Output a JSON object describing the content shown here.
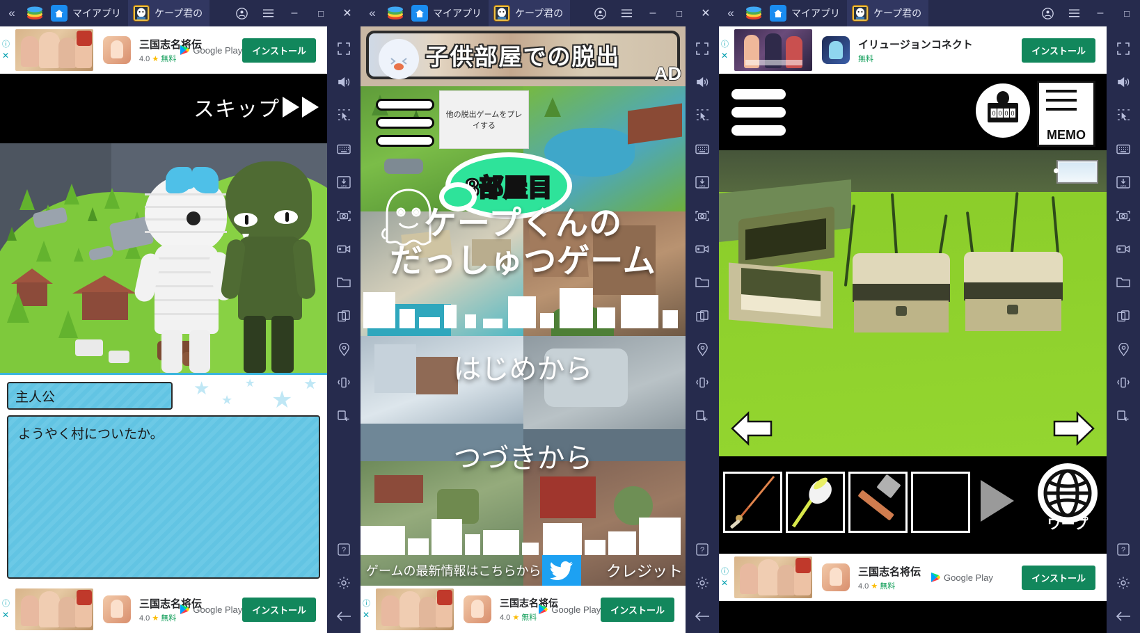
{
  "windows": [
    {
      "titlebar": {
        "collapse_icon": "chevron-double-left-icon",
        "logo_icon": "bluestacks-logo-icon",
        "tabs": [
          {
            "label": "マイアプリ",
            "icon": "home-icon",
            "active": false
          },
          {
            "label": "ケープ君の",
            "icon": "game-app-icon",
            "active": true
          }
        ],
        "account_icon": "account-circle-icon",
        "menu_icon": "hamburger-menu-icon",
        "minimize_label": "–",
        "maximize_label": "□",
        "close_label": "✕"
      },
      "top_ad": {
        "title": "三国志名将伝",
        "rating": "4.0",
        "star": "★",
        "price": "無料",
        "store": "Google Play",
        "install_label": "インストール",
        "info_icon": "info-icon",
        "close_icon": "close-icon"
      },
      "game": {
        "skip_label": "スキップ",
        "skip_arrow": "▶▶",
        "speaker_name": "主人公",
        "dialogue": "ようやく村についたか。"
      },
      "bottom_ad": {
        "title": "三国志名将伝",
        "rating": "4.0",
        "star": "★",
        "price": "無料",
        "store": "Google Play",
        "install_label": "インストール",
        "info_icon": "info-icon",
        "close_icon": "close-icon"
      }
    },
    {
      "titlebar": {
        "collapse_icon": "chevron-double-left-icon",
        "logo_icon": "bluestacks-logo-icon",
        "tabs": [
          {
            "label": "マイアプリ",
            "icon": "home-icon",
            "active": false
          },
          {
            "label": "ケープ君の",
            "icon": "game-app-icon",
            "active": true
          }
        ],
        "account_icon": "account-circle-icon",
        "menu_icon": "hamburger-menu-icon",
        "minimize_label": "–",
        "maximize_label": "□",
        "close_label": "✕"
      },
      "banner_ad": {
        "title": "子供部屋での脱出",
        "ad_mark": "AD"
      },
      "title_screen": {
        "menu_icon": "hamburger-menu-icon",
        "other_games_label": "他の脱出ゲームをプレイする",
        "room_bubble": "8部屋目",
        "logo_line1": "ケープくんの",
        "logo_line2": "だっしゅつゲーム",
        "mascot_icon": "ghost-mascot-icon",
        "new_game_label": "はじめから",
        "continue_label": "つづきから",
        "news_label": "ゲームの最新情報はこちらから",
        "twitter_icon": "twitter-bird-icon",
        "credits_label": "クレジット"
      },
      "bottom_ad": {
        "title": "三国志名将伝",
        "rating": "4.0",
        "star": "★",
        "price": "無料",
        "store": "Google Play",
        "install_label": "インストール",
        "info_icon": "info-icon",
        "close_icon": "close-icon"
      }
    },
    {
      "titlebar": {
        "collapse_icon": "chevron-double-left-icon",
        "logo_icon": "bluestacks-logo-icon",
        "tabs": [
          {
            "label": "マイアプリ",
            "icon": "home-icon",
            "active": false
          },
          {
            "label": "ケープ君の",
            "icon": "game-app-icon",
            "active": true
          }
        ],
        "account_icon": "account-circle-icon",
        "menu_icon": "hamburger-menu-icon",
        "minimize_label": "–",
        "maximize_label": "□",
        "close_label": "✕"
      },
      "top_ad": {
        "title": "イリュージョンコネクト",
        "price": "無料",
        "install_label": "インストール",
        "info_icon": "info-icon",
        "close_icon": "close-icon"
      },
      "game": {
        "menu_icon": "hamburger-menu-icon",
        "combination_lock_icon": "combination-lock-icon",
        "lock_digits": "0000",
        "memo_label": "MEMO",
        "memo_icon": "memo-notepad-icon",
        "minimap_icon": "minimap-icon",
        "nav_left_icon": "arrow-left-icon",
        "nav_right_icon": "arrow-right-icon",
        "inventory": [
          {
            "name": "fishing-rod-item",
            "filled": true
          },
          {
            "name": "butterfly-net-item",
            "filled": true
          },
          {
            "name": "hammer-item",
            "filled": true
          },
          {
            "name": "empty-slot",
            "filled": false
          }
        ],
        "inventory_next_icon": "inventory-next-arrow-icon",
        "warp_label": "ワープ",
        "warp_icon": "globe-icon"
      },
      "bottom_ad": {
        "title": "三国志名将伝",
        "rating": "4.0",
        "star": "★",
        "price": "無料",
        "store": "Google Play",
        "install_label": "インストール",
        "info_icon": "info-icon",
        "close_icon": "close-icon"
      }
    }
  ],
  "sidebar": {
    "items": [
      {
        "name": "fullscreen-icon"
      },
      {
        "name": "volume-icon"
      },
      {
        "name": "multi-instance-pointer-icon"
      },
      {
        "name": "keymapping-icon"
      },
      {
        "name": "install-apk-icon"
      },
      {
        "name": "screenshot-icon"
      },
      {
        "name": "screen-record-icon"
      },
      {
        "name": "media-folder-icon"
      },
      {
        "name": "multi-instance-manager-icon"
      },
      {
        "name": "location-icon"
      },
      {
        "name": "shake-icon"
      },
      {
        "name": "rotate-icon"
      }
    ],
    "bottom_items": [
      {
        "name": "help-icon"
      },
      {
        "name": "settings-gear-icon"
      },
      {
        "name": "back-icon"
      }
    ]
  },
  "colors": {
    "chrome_bg": "#262b4d",
    "tab_active": "#313761",
    "install_green": "#12875c",
    "dialog_blue": "#6cc9e6",
    "bubble_green": "#2ee39a",
    "twitter_blue": "#1da1f2",
    "grass_green": "#8ed42b"
  }
}
